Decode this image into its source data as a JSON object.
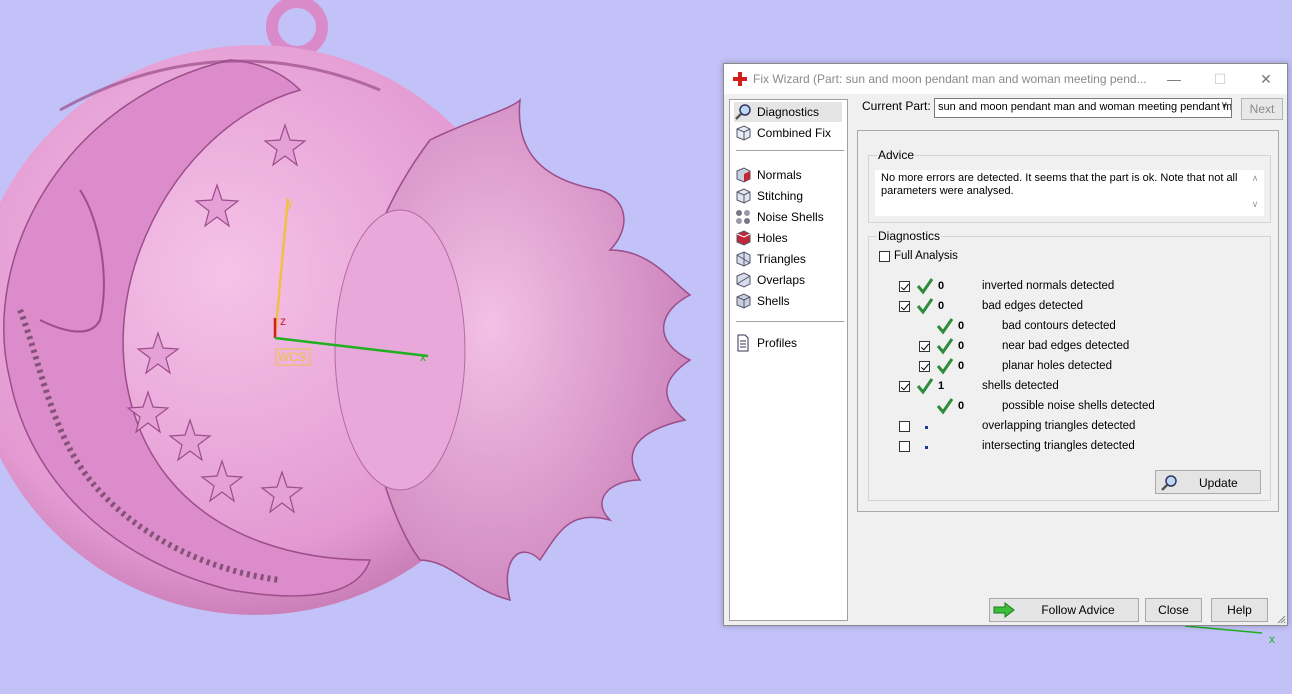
{
  "window": {
    "title": "Fix Wizard (Part: sun and moon pendant man and woman meeting pend...",
    "minimize_icon": "minimize-icon",
    "maximize_icon": "maximize-icon",
    "close_icon": "close-icon"
  },
  "viewport": {
    "axis_y": "y",
    "axis_z": "z",
    "axis_x": "x",
    "wcs_label": "WCS",
    "corner_axis_x": "x"
  },
  "nav": {
    "items": [
      {
        "label": "Diagnostics",
        "icon": "magnifier-icon"
      },
      {
        "label": "Combined Fix",
        "icon": "cube-icon"
      },
      {
        "label": "Normals",
        "icon": "normals-cube-icon"
      },
      {
        "label": "Stitching",
        "icon": "stitching-cube-icon"
      },
      {
        "label": "Noise Shells",
        "icon": "noise-shells-icon"
      },
      {
        "label": "Holes",
        "icon": "holes-cube-icon"
      },
      {
        "label": "Triangles",
        "icon": "triangles-cube-icon"
      },
      {
        "label": "Overlaps",
        "icon": "overlaps-cube-icon"
      },
      {
        "label": "Shells",
        "icon": "shells-cube-icon"
      },
      {
        "label": "Profiles",
        "icon": "document-icon"
      }
    ]
  },
  "current_part": {
    "label": "Current Part:",
    "value": "sun and moon pendant man and woman meeting pendant m",
    "next_label": "Next"
  },
  "advice": {
    "label": "Advice",
    "text": "No more errors are detected. It seems that the part is ok. Note that not all parameters were analysed."
  },
  "diagnostics": {
    "label": "Diagnostics",
    "full_analysis_label": "Full Analysis",
    "rows": [
      {
        "count": "0",
        "text": "inverted normals detected"
      },
      {
        "count": "0",
        "text": "bad edges detected"
      },
      {
        "count": "0",
        "text": "bad contours detected"
      },
      {
        "count": "0",
        "text": "near bad edges detected"
      },
      {
        "count": "0",
        "text": "planar holes detected"
      },
      {
        "count": "1",
        "text": "shells detected"
      },
      {
        "count": "0",
        "text": "possible noise shells detected"
      },
      {
        "count": "",
        "text": "overlapping triangles detected"
      },
      {
        "count": "",
        "text": "intersecting triangles detected"
      }
    ],
    "update_label": "Update"
  },
  "footer": {
    "follow_advice_label": "Follow Advice",
    "close_label": "Close",
    "help_label": "Help"
  },
  "colors": {
    "background": "#c3c2f8",
    "model": "#e39ad2",
    "check_green": "#2e8b3a"
  }
}
